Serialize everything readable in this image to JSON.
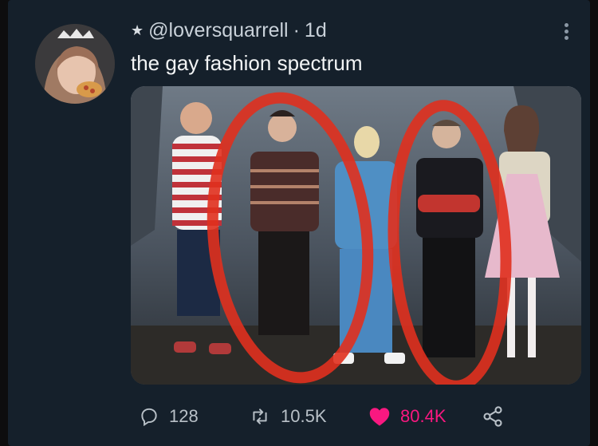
{
  "tweet": {
    "handle": "@loversquarrell",
    "separator": "·",
    "time": "1d",
    "text": "the gay fashion spectrum"
  },
  "actions": {
    "replies": "128",
    "retweets": "10.5K",
    "likes": "80.4K"
  },
  "colors": {
    "background": "#15202b",
    "like_accent": "#f91880",
    "annotation_red": "#e0301e"
  },
  "icons": [
    "star-icon",
    "more-icon",
    "reply-icon",
    "retweet-icon",
    "heart-icon",
    "share-icon"
  ]
}
